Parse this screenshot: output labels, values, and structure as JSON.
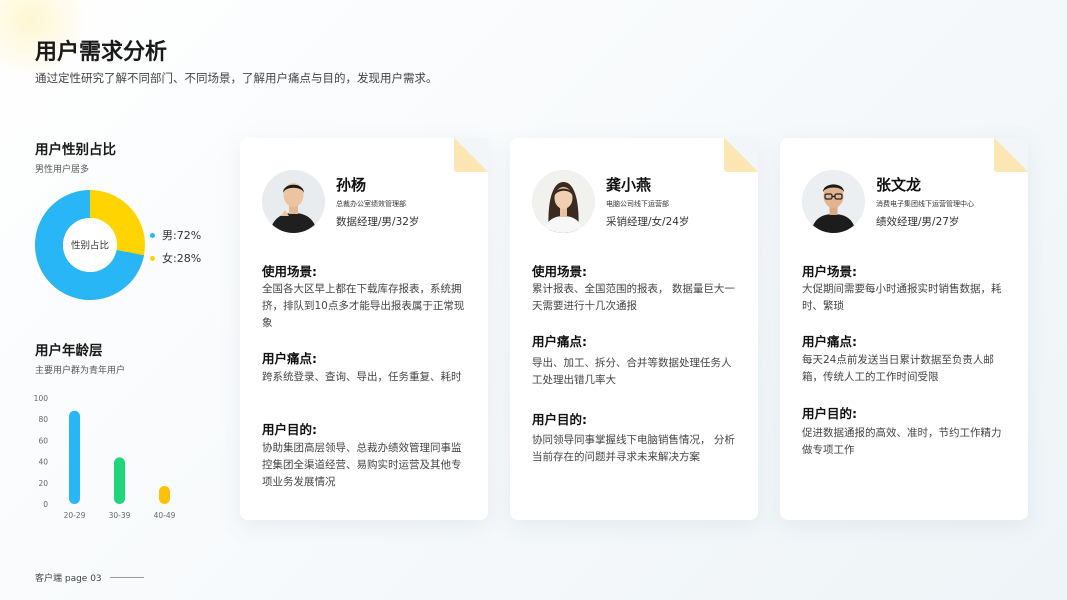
{
  "page": {
    "title": "用户需求分析",
    "subtitle": "通过定性研究了解不同部门、不同场景，了解用户痛点与目的，发现用户需求。"
  },
  "gender": {
    "title": "用户性别占比",
    "subtitle": "男性用户居多",
    "center_label": "性别占比",
    "legend": [
      {
        "label": "男:72%",
        "color": "#29b6f6",
        "value": 72
      },
      {
        "label": "女:28%",
        "color": "#ffd400",
        "value": 28
      }
    ]
  },
  "age": {
    "title": "用户年龄层",
    "subtitle": "主要用户群为青年用户"
  },
  "chart_data": {
    "type": "bar",
    "categories": [
      "20-29",
      "30-39",
      "40-49"
    ],
    "values": [
      88,
      44,
      17
    ],
    "colors": [
      "#29b6f6",
      "#1fd67a",
      "#ffc107"
    ],
    "yticks": [
      "100",
      "80",
      "60",
      "40",
      "20",
      "0"
    ],
    "ylim": [
      0,
      100
    ],
    "grid": false
  },
  "cards": [
    {
      "name": "孙杨",
      "dept": "总裁办公室绩效管理部",
      "role": "数据经理/男/32岁",
      "scene_heading": "使用场景:",
      "scene_text": "全国各大区早上都在下载库存报表，系统拥挤，排队到10点多才能导出报表属于正常现象",
      "pain_heading": "用户痛点:",
      "pain_text": "跨系统登录、查询、导出，任务重复、耗时",
      "goal_heading": "用户目的:",
      "goal_text": "协助集团高层领导、总裁办绩效管理同事监控集团全渠道经营、易购实时运营及其他专项业务发展情况"
    },
    {
      "name": "龚小燕",
      "dept": "电脑公司线下运营部",
      "role": "采销经理/女/24岁",
      "scene_heading": "使用场景:",
      "scene_text": "累计报表、全国范围的报表， 数据量巨大一天需要进行十几次通报",
      "pain_heading": "用户痛点:",
      "pain_text": "导出、加工、拆分、合并等数据处理任务人工处理出错几率大",
      "goal_heading": "用户目的:",
      "goal_text": "协同领导同事掌握线下电脑销售情况， 分析当前存在的问题并寻求未来解决方案"
    },
    {
      "name": "张文龙",
      "dept": "消费电子集团线下运营管理中心",
      "role": "绩效经理/男/27岁",
      "scene_heading": "用户场景:",
      "scene_text": "大促期间需要每小时通报实时销售数据，耗时、繁琐",
      "pain_heading": "用户痛点:",
      "pain_text": "每天24点前发送当日累计数据至负责人邮箱，传统人工的工作时间受限",
      "goal_heading": "用户目的:",
      "goal_text": "促进数据通报的高效、准时，节约工作精力做专项工作"
    }
  ],
  "footer": {
    "text": "客户端 page 03"
  }
}
